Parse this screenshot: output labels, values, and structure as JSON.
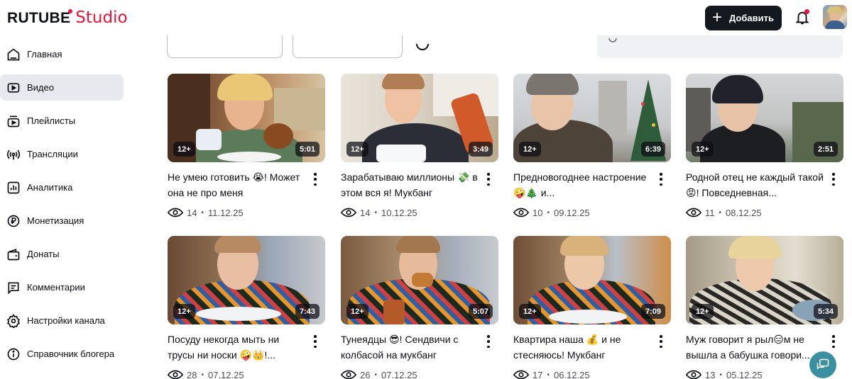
{
  "header": {
    "logo_main": "RUTUBE",
    "logo_sub": "Studio",
    "add_button": "Добавить",
    "accent": "#ed143b"
  },
  "sidebar": {
    "items": [
      {
        "label": "Главная",
        "icon": "home-icon"
      },
      {
        "label": "Видео",
        "icon": "video-icon",
        "active": true
      },
      {
        "label": "Плейлисты",
        "icon": "playlist-icon"
      },
      {
        "label": "Трансляции",
        "icon": "broadcast-icon"
      },
      {
        "label": "Аналитика",
        "icon": "analytics-icon"
      },
      {
        "label": "Монетизация",
        "icon": "ruble-icon"
      },
      {
        "label": "Донаты",
        "icon": "wallet-icon"
      },
      {
        "label": "Комментарии",
        "icon": "comment-icon"
      },
      {
        "label": "Настройки канала",
        "icon": "gear-icon"
      },
      {
        "label": "Справочник блогера",
        "icon": "info-icon"
      }
    ]
  },
  "videos": [
    {
      "title": "Не умею готовить 😭! Может она не про меня",
      "age": "12+",
      "duration": "5:01",
      "views": "14",
      "date": "11.12.25"
    },
    {
      "title": "Зарабатываю миллионы 💸 в этом вся я! Мукбанг",
      "age": "12+",
      "duration": "3:49",
      "views": "14",
      "date": "10.12.25"
    },
    {
      "title": "Предновогоднее настроение 🤪🎄 и...",
      "age": "12+",
      "duration": "6:39",
      "views": "10",
      "date": "09.12.25"
    },
    {
      "title": "Родной отец не каждый такой 😡! Повседневная...",
      "age": "12+",
      "duration": "2:51",
      "views": "11",
      "date": "08.12.25"
    },
    {
      "title": "Посуду некогда мыть ни трусы ни носки 🤪👑!...",
      "age": "12+",
      "duration": "7:43",
      "views": "28",
      "date": "07.12.25"
    },
    {
      "title": "Тунеядцы 😎! Сендвичи с колбасой на мукбанг",
      "age": "12+",
      "duration": "5:07",
      "views": "26",
      "date": "07.12.25"
    },
    {
      "title": "Квартира наша 💰 и не стесняюсь! Мукбанг",
      "age": "12+",
      "duration": "7:09",
      "views": "17",
      "date": "06.12.25"
    },
    {
      "title": "Муж говорит я рыл😑м не вышла а бабушка говори...",
      "age": "12+",
      "duration": "5:34",
      "views": "13",
      "date": "05.12.25"
    }
  ]
}
